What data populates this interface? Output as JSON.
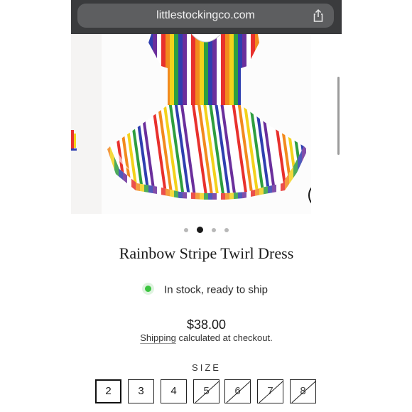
{
  "browser": {
    "url": "littlestockingco.com",
    "share_icon": "share-icon"
  },
  "gallery": {
    "dots_count": 4,
    "active_index": 1,
    "zoom_icon": "magnifier-icon"
  },
  "product": {
    "title": "Rainbow Stripe Twirl Dress",
    "stock_status": "In stock, ready to ship",
    "price": "$38.00",
    "shipping_link": "Shipping",
    "shipping_note": " calculated at checkout."
  },
  "size_selector": {
    "label": "SIZE",
    "options": [
      {
        "label": "2",
        "selected": true,
        "sold_out": false
      },
      {
        "label": "3",
        "selected": false,
        "sold_out": false
      },
      {
        "label": "4",
        "selected": false,
        "sold_out": false
      },
      {
        "label": "5",
        "selected": false,
        "sold_out": true
      },
      {
        "label": "6",
        "selected": false,
        "sold_out": true
      },
      {
        "label": "7",
        "selected": false,
        "sold_out": true
      },
      {
        "label": "8",
        "selected": false,
        "sold_out": true
      }
    ]
  },
  "colors": {
    "accent_green": "#3bc43f",
    "stripes": [
      "#e8312d",
      "#f28a1e",
      "#f3d21b",
      "#2e9e3f",
      "#2f3fb0",
      "#6b2f9c",
      "#ffffff"
    ]
  }
}
